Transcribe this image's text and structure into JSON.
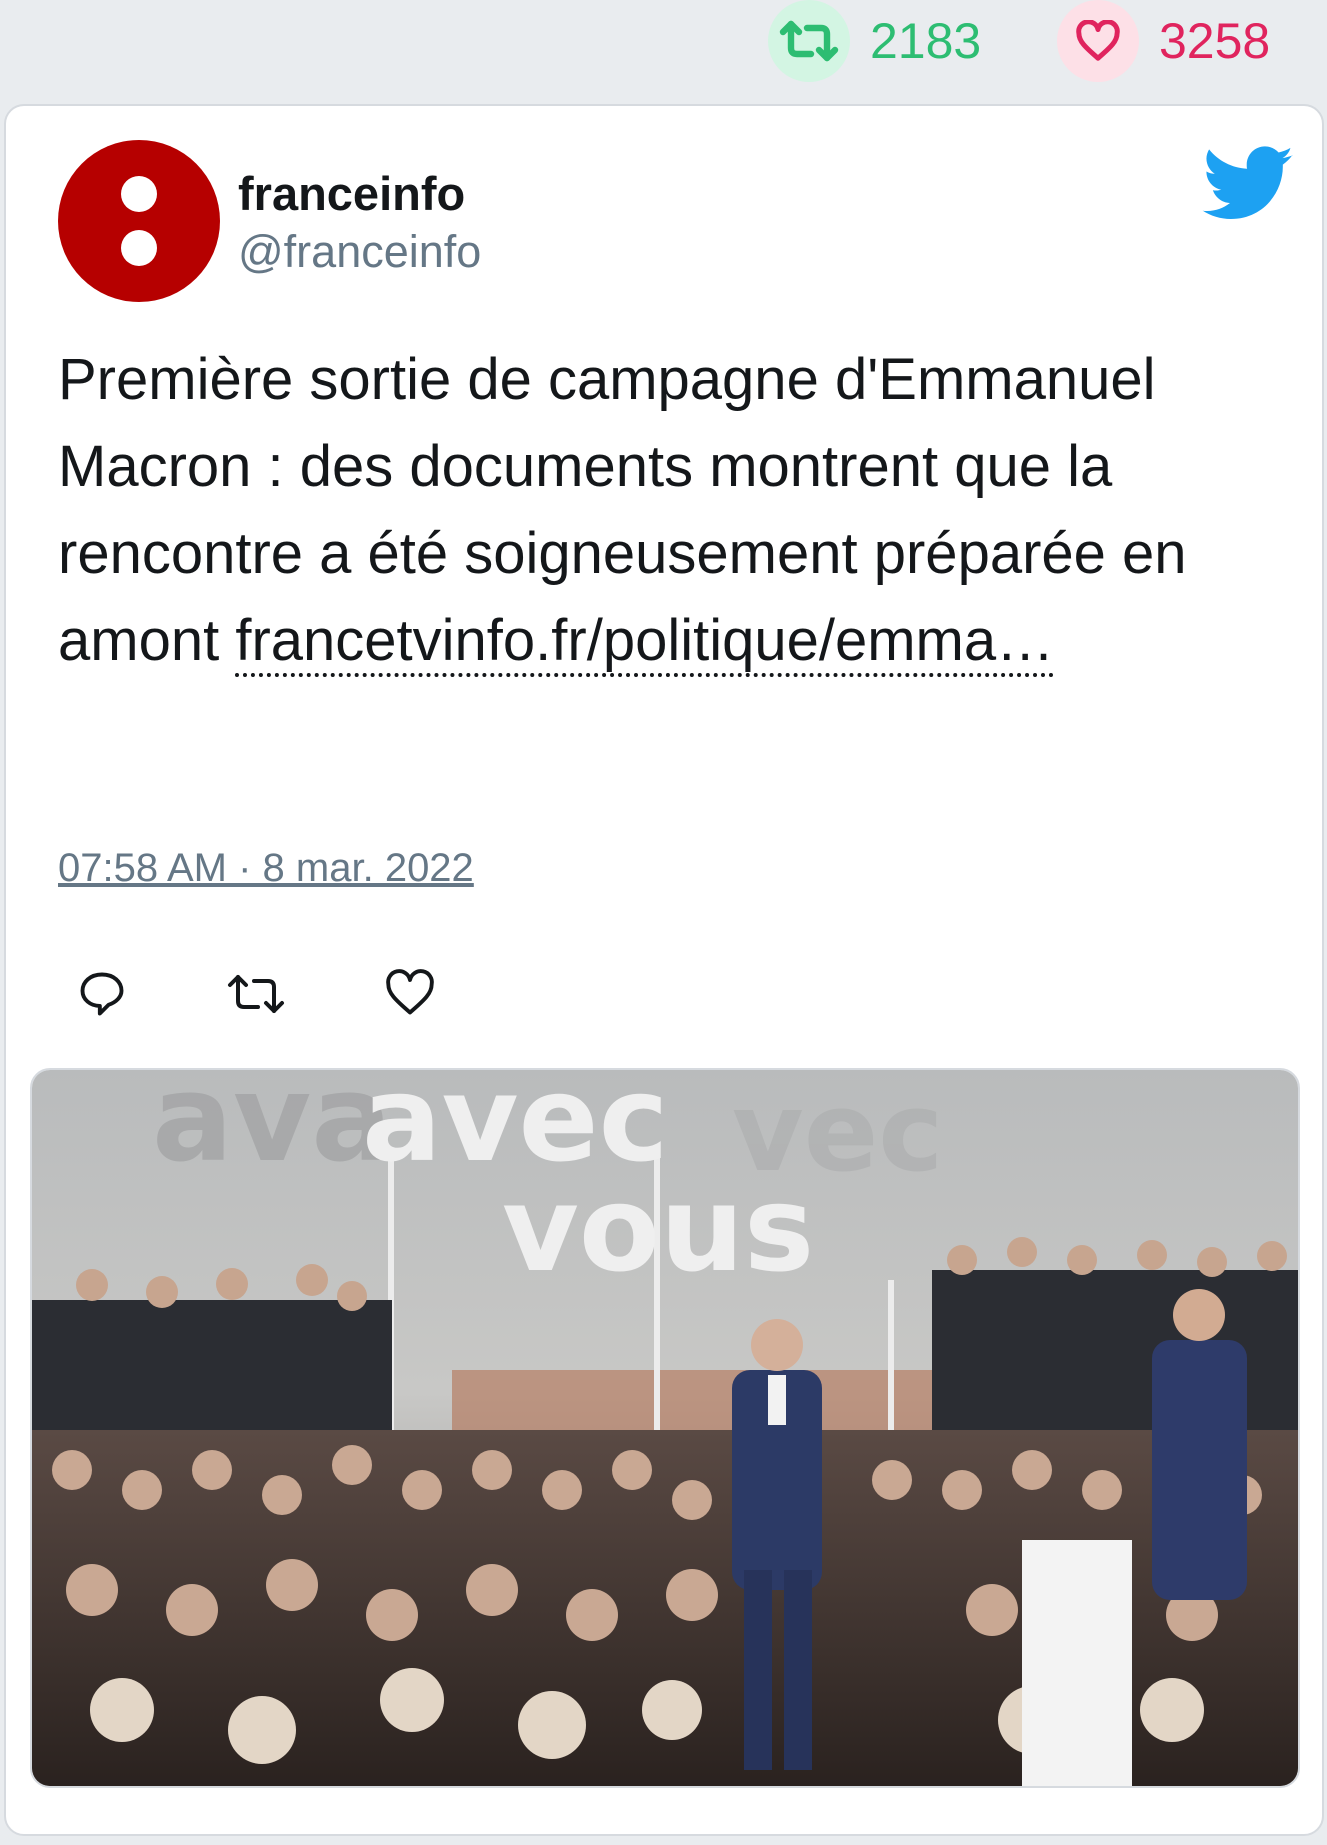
{
  "stats": {
    "retweets": "2183",
    "likes": "3258",
    "retweet_color": "#2dbd72",
    "like_color": "#e0245e"
  },
  "tweet": {
    "author_name": "franceinfo",
    "author_handle": "@franceinfo",
    "avatar_icon": "franceinfo-logo",
    "platform_icon": "twitter-bird-icon",
    "text": "Première sortie de campagne d'Emmanuel Macron : des documents montrent que la rencontre a été soigneusement préparée en amont ",
    "link_text": "francetvinfo.fr/politique/emma…",
    "timestamp": "07:58 AM · 8 mar. 2022",
    "actions": [
      "reply-icon",
      "retweet-icon",
      "like-icon"
    ]
  },
  "media": {
    "sign_line1": "avec",
    "sign_line2": "vous"
  }
}
